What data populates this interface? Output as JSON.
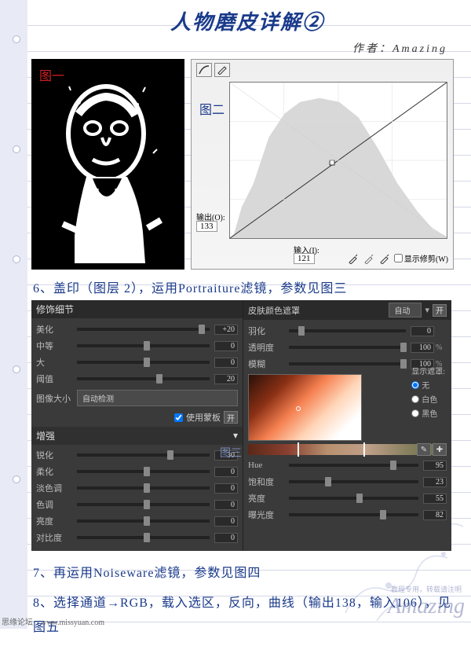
{
  "title": "人物磨皮详解②",
  "author": "作者：Amazing",
  "fig1": {
    "label": "图一"
  },
  "fig2": {
    "label": "图二",
    "output_label": "输出(O):",
    "output_value": "133",
    "input_label": "输入(I):",
    "input_value": "121",
    "show_clip": "显示修剪(W)"
  },
  "step6": "6、盖印（图层 2），运用Portraiture滤镜，参数见图三",
  "panel": {
    "left_header": "修饰细节",
    "right_header": "皮肤颜色遮罩",
    "auto": "自动",
    "open": "开",
    "rows_left_top": [
      {
        "label": "美化",
        "value": "+20",
        "pos": 92
      },
      {
        "label": "中等",
        "value": "0",
        "pos": 50
      },
      {
        "label": "大",
        "value": "0",
        "pos": 50
      },
      {
        "label": "阈值",
        "value": "20",
        "pos": 60
      }
    ],
    "img_size_label": "图像大小",
    "img_size_value": "自动检测",
    "use_mask": "使用蒙板",
    "enhance": "增强",
    "rows_left_bottom": [
      {
        "label": "锐化",
        "value": "30",
        "pos": 68
      },
      {
        "label": "柔化",
        "value": "0",
        "pos": 50
      },
      {
        "label": "淡色调",
        "value": "0",
        "pos": 50
      },
      {
        "label": "色调",
        "value": "0",
        "pos": 50
      },
      {
        "label": "亮度",
        "value": "0",
        "pos": 50
      },
      {
        "label": "对比度",
        "value": "0",
        "pos": 50
      }
    ],
    "rows_right_top": [
      {
        "label": "羽化",
        "value": "0",
        "unit": "",
        "pos": 8
      },
      {
        "label": "透明度",
        "value": "100",
        "unit": "%",
        "pos": 95
      },
      {
        "label": "模糊",
        "value": "100",
        "unit": "%",
        "pos": 95
      }
    ],
    "mask_label": "显示遮罩:",
    "mask_opts": [
      "无",
      "白色",
      "黑色"
    ],
    "fig3_label": "图三",
    "rows_right_bottom": [
      {
        "label": "Hue",
        "value": "95",
        "pos": 78
      },
      {
        "label": "饱和度",
        "value": "23",
        "pos": 28
      },
      {
        "label": "亮度",
        "value": "55",
        "pos": 52
      },
      {
        "label": "曝光度",
        "value": "82",
        "pos": 70
      }
    ]
  },
  "step7": "7、再运用Noiseware滤镜，参数见图四",
  "step8": "8、选择通道→RGB，载入选区，反向，曲线（输出138，输入106），见图五",
  "watermark": "Amazing",
  "wm_sub": "教程专用，转载请注明",
  "footer": "思缘论坛　www.missyuan.com"
}
